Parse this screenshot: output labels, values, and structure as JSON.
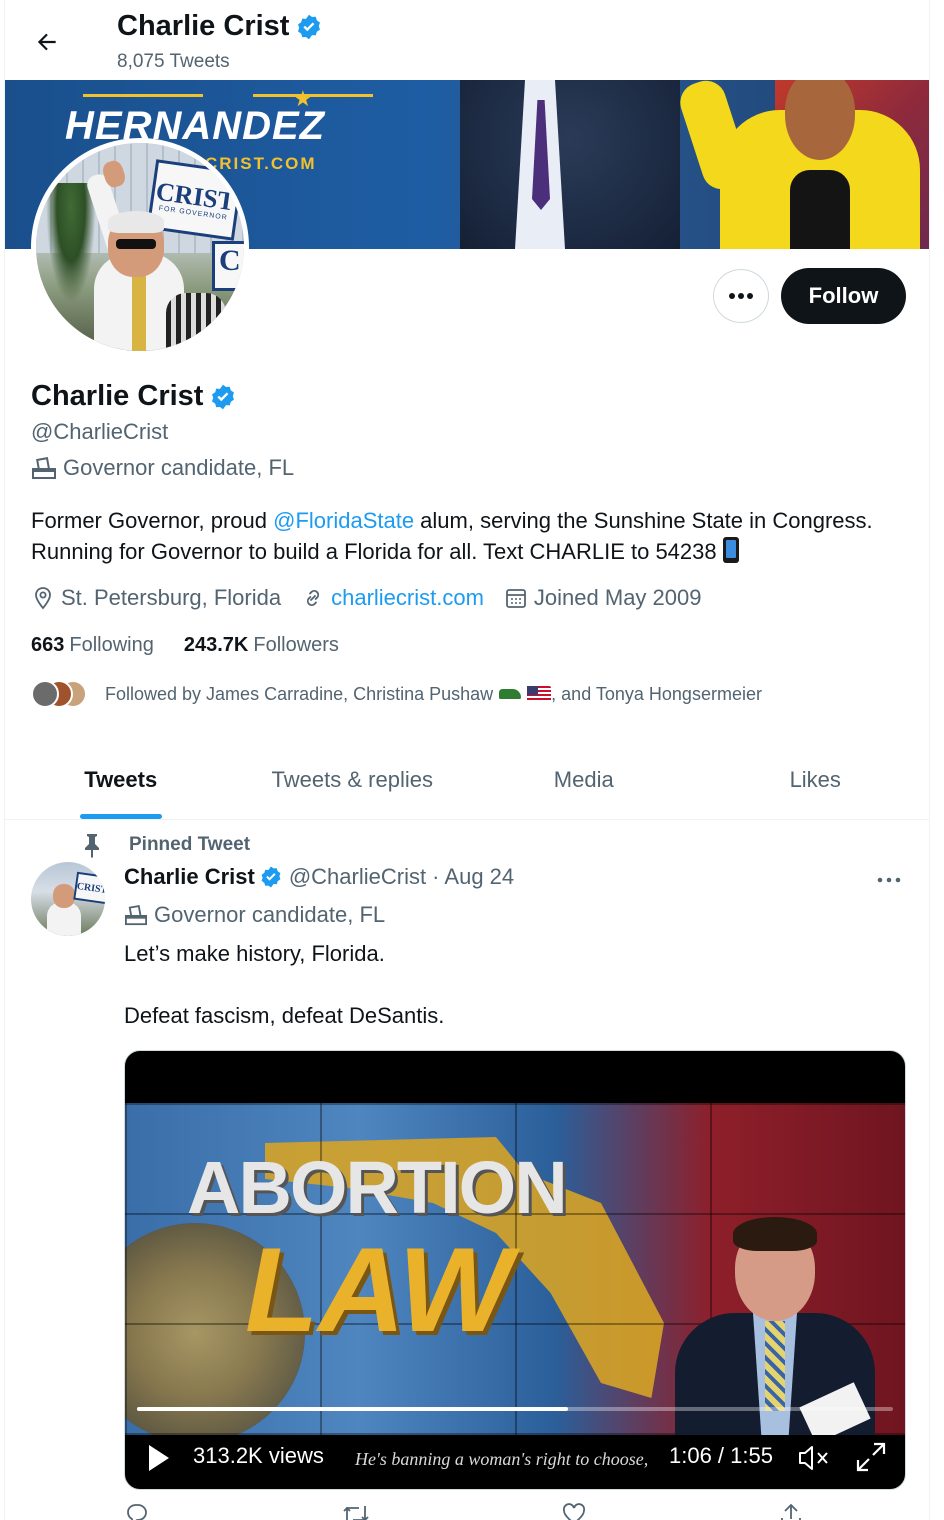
{
  "header": {
    "name": "Charlie Crist",
    "tweet_count": "8,075 Tweets"
  },
  "banner": {
    "title": "HERNANDEZ",
    "site": "CRIST.COM"
  },
  "avatar": {
    "sign_text": "CRIST",
    "sign_sub": "FOR GOVERNOR",
    "sign2_letter": "C"
  },
  "actions": {
    "follow_label": "Follow"
  },
  "profile": {
    "name": "Charlie Crist",
    "handle": "@CharlieCrist",
    "category": "Governor candidate, FL",
    "bio_part1": "Former Governor, proud ",
    "bio_link": "@FloridaState",
    "bio_part2": " alum, serving the Sunshine State in Congress. Running for Governor to build a Florida for all. Text CHARLIE to 54238",
    "location": "St. Petersburg, Florida",
    "website": "charliecrist.com",
    "joined": "Joined May 2009",
    "following_count": "663",
    "following_label": "Following",
    "followers_count": "243.7K",
    "followers_label": "Followers",
    "followed_by_part1": "Followed by James Carradine, Christina Pushaw",
    "followed_by_part2": ", and Tonya Hongsermeier"
  },
  "tabs": [
    {
      "label": "Tweets",
      "active": true
    },
    {
      "label": "Tweets & replies",
      "active": false
    },
    {
      "label": "Media",
      "active": false
    },
    {
      "label": "Likes",
      "active": false
    }
  ],
  "tweet": {
    "pinned_label": "Pinned Tweet",
    "name": "Charlie Crist",
    "handle_date": "@CharlieCrist · Aug 24",
    "category": "Governor candidate, FL",
    "avatar_sign": "CRIST",
    "text_line1": "Let’s make history, Florida.",
    "text_line2": "Defeat fascism, defeat DeSantis.",
    "video": {
      "headline_word1": "ABORTION",
      "headline_word2": "LAW",
      "views": "313.2K views",
      "caption": "He's banning a woman's right to choose,",
      "time": "1:06 / 1:55",
      "progress_fraction": 0.57
    }
  },
  "colors": {
    "accent": "#1d9bf0",
    "text": "#0f1419",
    "secondary": "#536471",
    "follow_bg": "#0f1419"
  }
}
